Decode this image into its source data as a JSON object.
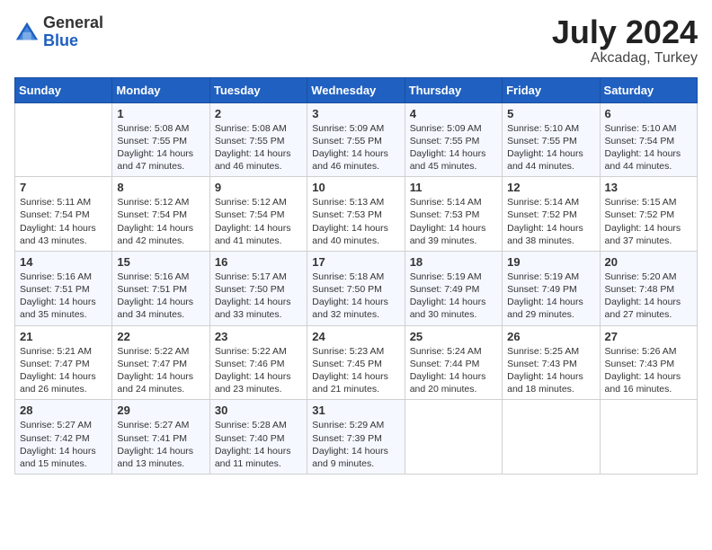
{
  "header": {
    "logo_general": "General",
    "logo_blue": "Blue",
    "month_title": "July 2024",
    "location": "Akcadag, Turkey"
  },
  "weekdays": [
    "Sunday",
    "Monday",
    "Tuesday",
    "Wednesday",
    "Thursday",
    "Friday",
    "Saturday"
  ],
  "weeks": [
    [
      {
        "day": "",
        "sunrise": "",
        "sunset": "",
        "daylight": ""
      },
      {
        "day": "1",
        "sunrise": "Sunrise: 5:08 AM",
        "sunset": "Sunset: 7:55 PM",
        "daylight": "Daylight: 14 hours and 47 minutes."
      },
      {
        "day": "2",
        "sunrise": "Sunrise: 5:08 AM",
        "sunset": "Sunset: 7:55 PM",
        "daylight": "Daylight: 14 hours and 46 minutes."
      },
      {
        "day": "3",
        "sunrise": "Sunrise: 5:09 AM",
        "sunset": "Sunset: 7:55 PM",
        "daylight": "Daylight: 14 hours and 46 minutes."
      },
      {
        "day": "4",
        "sunrise": "Sunrise: 5:09 AM",
        "sunset": "Sunset: 7:55 PM",
        "daylight": "Daylight: 14 hours and 45 minutes."
      },
      {
        "day": "5",
        "sunrise": "Sunrise: 5:10 AM",
        "sunset": "Sunset: 7:55 PM",
        "daylight": "Daylight: 14 hours and 44 minutes."
      },
      {
        "day": "6",
        "sunrise": "Sunrise: 5:10 AM",
        "sunset": "Sunset: 7:54 PM",
        "daylight": "Daylight: 14 hours and 44 minutes."
      }
    ],
    [
      {
        "day": "7",
        "sunrise": "Sunrise: 5:11 AM",
        "sunset": "Sunset: 7:54 PM",
        "daylight": "Daylight: 14 hours and 43 minutes."
      },
      {
        "day": "8",
        "sunrise": "Sunrise: 5:12 AM",
        "sunset": "Sunset: 7:54 PM",
        "daylight": "Daylight: 14 hours and 42 minutes."
      },
      {
        "day": "9",
        "sunrise": "Sunrise: 5:12 AM",
        "sunset": "Sunset: 7:54 PM",
        "daylight": "Daylight: 14 hours and 41 minutes."
      },
      {
        "day": "10",
        "sunrise": "Sunrise: 5:13 AM",
        "sunset": "Sunset: 7:53 PM",
        "daylight": "Daylight: 14 hours and 40 minutes."
      },
      {
        "day": "11",
        "sunrise": "Sunrise: 5:14 AM",
        "sunset": "Sunset: 7:53 PM",
        "daylight": "Daylight: 14 hours and 39 minutes."
      },
      {
        "day": "12",
        "sunrise": "Sunrise: 5:14 AM",
        "sunset": "Sunset: 7:52 PM",
        "daylight": "Daylight: 14 hours and 38 minutes."
      },
      {
        "day": "13",
        "sunrise": "Sunrise: 5:15 AM",
        "sunset": "Sunset: 7:52 PM",
        "daylight": "Daylight: 14 hours and 37 minutes."
      }
    ],
    [
      {
        "day": "14",
        "sunrise": "Sunrise: 5:16 AM",
        "sunset": "Sunset: 7:51 PM",
        "daylight": "Daylight: 14 hours and 35 minutes."
      },
      {
        "day": "15",
        "sunrise": "Sunrise: 5:16 AM",
        "sunset": "Sunset: 7:51 PM",
        "daylight": "Daylight: 14 hours and 34 minutes."
      },
      {
        "day": "16",
        "sunrise": "Sunrise: 5:17 AM",
        "sunset": "Sunset: 7:50 PM",
        "daylight": "Daylight: 14 hours and 33 minutes."
      },
      {
        "day": "17",
        "sunrise": "Sunrise: 5:18 AM",
        "sunset": "Sunset: 7:50 PM",
        "daylight": "Daylight: 14 hours and 32 minutes."
      },
      {
        "day": "18",
        "sunrise": "Sunrise: 5:19 AM",
        "sunset": "Sunset: 7:49 PM",
        "daylight": "Daylight: 14 hours and 30 minutes."
      },
      {
        "day": "19",
        "sunrise": "Sunrise: 5:19 AM",
        "sunset": "Sunset: 7:49 PM",
        "daylight": "Daylight: 14 hours and 29 minutes."
      },
      {
        "day": "20",
        "sunrise": "Sunrise: 5:20 AM",
        "sunset": "Sunset: 7:48 PM",
        "daylight": "Daylight: 14 hours and 27 minutes."
      }
    ],
    [
      {
        "day": "21",
        "sunrise": "Sunrise: 5:21 AM",
        "sunset": "Sunset: 7:47 PM",
        "daylight": "Daylight: 14 hours and 26 minutes."
      },
      {
        "day": "22",
        "sunrise": "Sunrise: 5:22 AM",
        "sunset": "Sunset: 7:47 PM",
        "daylight": "Daylight: 14 hours and 24 minutes."
      },
      {
        "day": "23",
        "sunrise": "Sunrise: 5:22 AM",
        "sunset": "Sunset: 7:46 PM",
        "daylight": "Daylight: 14 hours and 23 minutes."
      },
      {
        "day": "24",
        "sunrise": "Sunrise: 5:23 AM",
        "sunset": "Sunset: 7:45 PM",
        "daylight": "Daylight: 14 hours and 21 minutes."
      },
      {
        "day": "25",
        "sunrise": "Sunrise: 5:24 AM",
        "sunset": "Sunset: 7:44 PM",
        "daylight": "Daylight: 14 hours and 20 minutes."
      },
      {
        "day": "26",
        "sunrise": "Sunrise: 5:25 AM",
        "sunset": "Sunset: 7:43 PM",
        "daylight": "Daylight: 14 hours and 18 minutes."
      },
      {
        "day": "27",
        "sunrise": "Sunrise: 5:26 AM",
        "sunset": "Sunset: 7:43 PM",
        "daylight": "Daylight: 14 hours and 16 minutes."
      }
    ],
    [
      {
        "day": "28",
        "sunrise": "Sunrise: 5:27 AM",
        "sunset": "Sunset: 7:42 PM",
        "daylight": "Daylight: 14 hours and 15 minutes."
      },
      {
        "day": "29",
        "sunrise": "Sunrise: 5:27 AM",
        "sunset": "Sunset: 7:41 PM",
        "daylight": "Daylight: 14 hours and 13 minutes."
      },
      {
        "day": "30",
        "sunrise": "Sunrise: 5:28 AM",
        "sunset": "Sunset: 7:40 PM",
        "daylight": "Daylight: 14 hours and 11 minutes."
      },
      {
        "day": "31",
        "sunrise": "Sunrise: 5:29 AM",
        "sunset": "Sunset: 7:39 PM",
        "daylight": "Daylight: 14 hours and 9 minutes."
      },
      {
        "day": "",
        "sunrise": "",
        "sunset": "",
        "daylight": ""
      },
      {
        "day": "",
        "sunrise": "",
        "sunset": "",
        "daylight": ""
      },
      {
        "day": "",
        "sunrise": "",
        "sunset": "",
        "daylight": ""
      }
    ]
  ]
}
